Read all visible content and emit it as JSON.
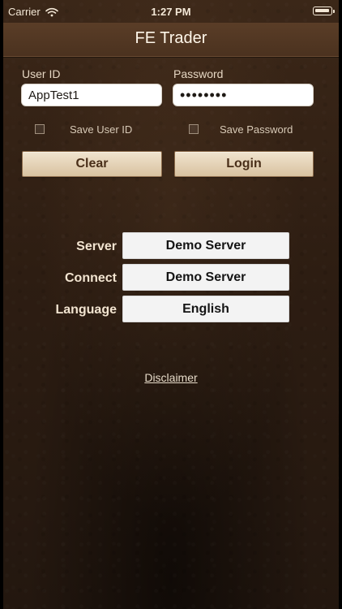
{
  "status_bar": {
    "carrier": "Carrier",
    "time": "1:27 PM"
  },
  "header": {
    "title": "FE Trader"
  },
  "login": {
    "user_id_label": "User ID",
    "user_id_value": "AppTest1",
    "password_label": "Password",
    "password_value": "••••••••",
    "save_user_id_label": "Save User ID",
    "save_password_label": "Save Password",
    "clear_label": "Clear",
    "login_label": "Login"
  },
  "settings": {
    "server_label": "Server",
    "server_value": "Demo Server",
    "connect_label": "Connect",
    "connect_value": "Demo Server",
    "language_label": "Language",
    "language_value": "English"
  },
  "footer": {
    "disclaimer_label": "Disclaimer"
  },
  "colors": {
    "header_bg": "#4b321f",
    "button_text": "#4a2f19",
    "leather_bg": "#2d1d12"
  }
}
